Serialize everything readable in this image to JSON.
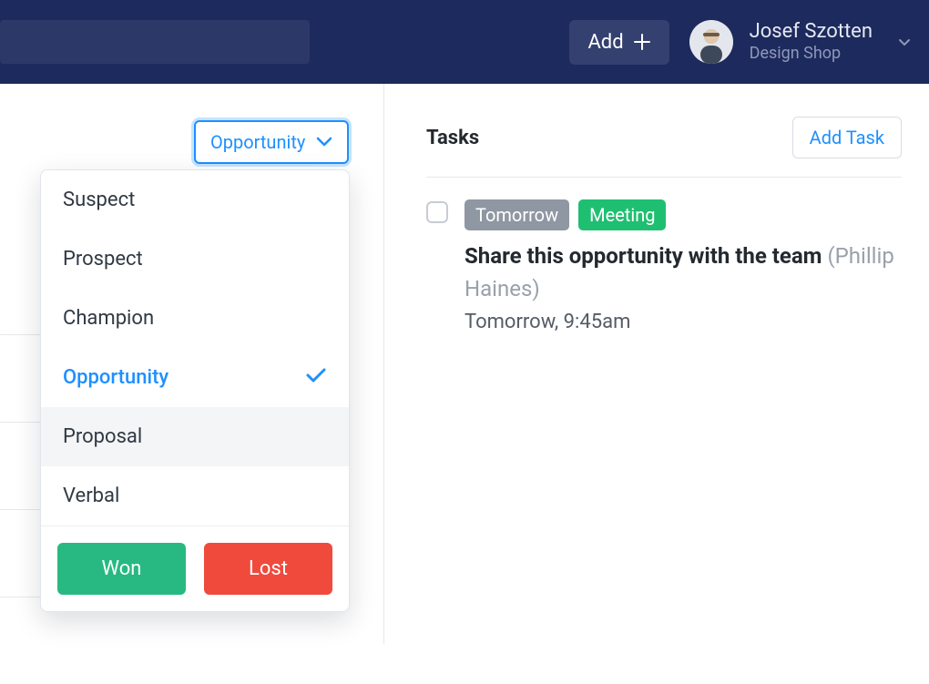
{
  "header": {
    "add_label": "Add",
    "user_name": "Josef Szotten",
    "user_company": "Design Shop"
  },
  "stage": {
    "trigger_label": "Opportunity",
    "options": [
      {
        "label": "Suspect",
        "selected": false,
        "hover": false
      },
      {
        "label": "Prospect",
        "selected": false,
        "hover": false
      },
      {
        "label": "Champion",
        "selected": false,
        "hover": false
      },
      {
        "label": "Opportunity",
        "selected": true,
        "hover": false
      },
      {
        "label": "Proposal",
        "selected": false,
        "hover": true
      },
      {
        "label": "Verbal",
        "selected": false,
        "hover": false
      }
    ],
    "won_label": "Won",
    "lost_label": "Lost"
  },
  "tasks": {
    "heading": "Tasks",
    "add_label": "Add Task",
    "item": {
      "badge_time": "Tomorrow",
      "badge_type": "Meeting",
      "title": "Share this opportunity with the team",
      "assignee": "(Phillip Haines)",
      "timestamp": "Tomorrow, 9:45am"
    }
  }
}
